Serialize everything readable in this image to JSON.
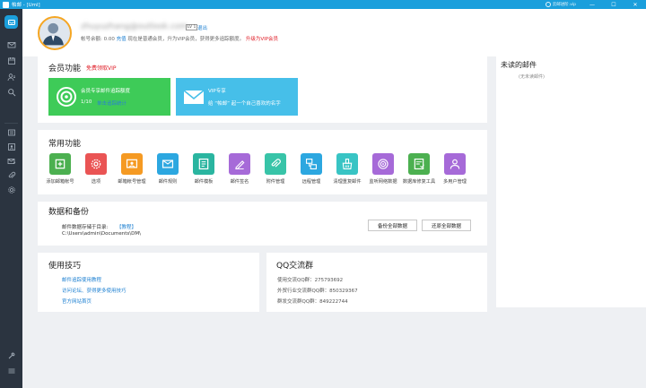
{
  "window": {
    "title": "帕邮 - [Uml]"
  },
  "brand": "云邮进阶.vip",
  "controls": {
    "minimize": "—",
    "maximize": "☐",
    "close": "✕"
  },
  "profile": {
    "email": "zhuyuzhang@outlook.com",
    "level": "LV 1",
    "logout": "退出",
    "balance_label": "帐号余额:",
    "balance": "0.00",
    "recharge": "充值",
    "notice": "现在是普通会员，升为VIP会员，获得更多追踪额度。",
    "upgrade": "升级为VIP会员"
  },
  "member": {
    "title": "会员功能",
    "free_vip": "免费领取VIP",
    "tile1": {
      "title": "会员专享邮件追踪额度",
      "count": "1/10",
      "link": "单击追踪统计"
    },
    "tile2": {
      "title": "VIP专享",
      "desc": "给 “帕邮” 起一个自己喜欢的名字"
    }
  },
  "common": {
    "title": "常用功能",
    "items": [
      {
        "label": "添加邮箱帐号",
        "color": "#4cb050",
        "icon": "add-account-icon"
      },
      {
        "label": "选项",
        "color": "#ea5454",
        "icon": "gear-icon"
      },
      {
        "label": "邮箱帐号管理",
        "color": "#f59a23",
        "icon": "account-manage-icon"
      },
      {
        "label": "邮件规则",
        "color": "#2ca7e0",
        "icon": "mail-rule-icon"
      },
      {
        "label": "邮件模板",
        "color": "#2ab5a0",
        "icon": "template-icon"
      },
      {
        "label": "邮件签名",
        "color": "#a66ad8",
        "icon": "signature-icon"
      },
      {
        "label": "附件管理",
        "color": "#38c4a8",
        "icon": "attachment-icon"
      },
      {
        "label": "远程管理",
        "color": "#2ca7e0",
        "icon": "remote-icon"
      },
      {
        "label": "清理重复邮件",
        "color": "#38c4c4",
        "icon": "clean-icon"
      },
      {
        "label": "监听网络数据",
        "color": "#a66ad8",
        "icon": "monitor-icon"
      },
      {
        "label": "数据库修复工具",
        "color": "#4cb050",
        "icon": "database-icon"
      },
      {
        "label": "多用户管理",
        "color": "#a66ad8",
        "icon": "users-icon"
      }
    ]
  },
  "backup": {
    "title": "数据和备份",
    "path_label": "邮件数据存储于目录:",
    "tutorial": "【教程】",
    "path": "C:\\Users\\admin\\Documents\\DM\\",
    "backup_btn": "备份全部数据",
    "restore_btn": "还原全部数据"
  },
  "tips": {
    "title": "使用技巧",
    "links": [
      "邮件追踪使用教程",
      "访问论坛、获得更多使用技巧",
      "官方网站首页"
    ]
  },
  "qq": {
    "title": "QQ交流群",
    "lines": [
      "使用交流QQ群：275793692",
      "外贸行业交流群QQ群：850329367",
      "群发交流群QQ群：849222744"
    ]
  },
  "unread": {
    "title": "未读的邮件",
    "empty": "(无未读邮件)"
  }
}
